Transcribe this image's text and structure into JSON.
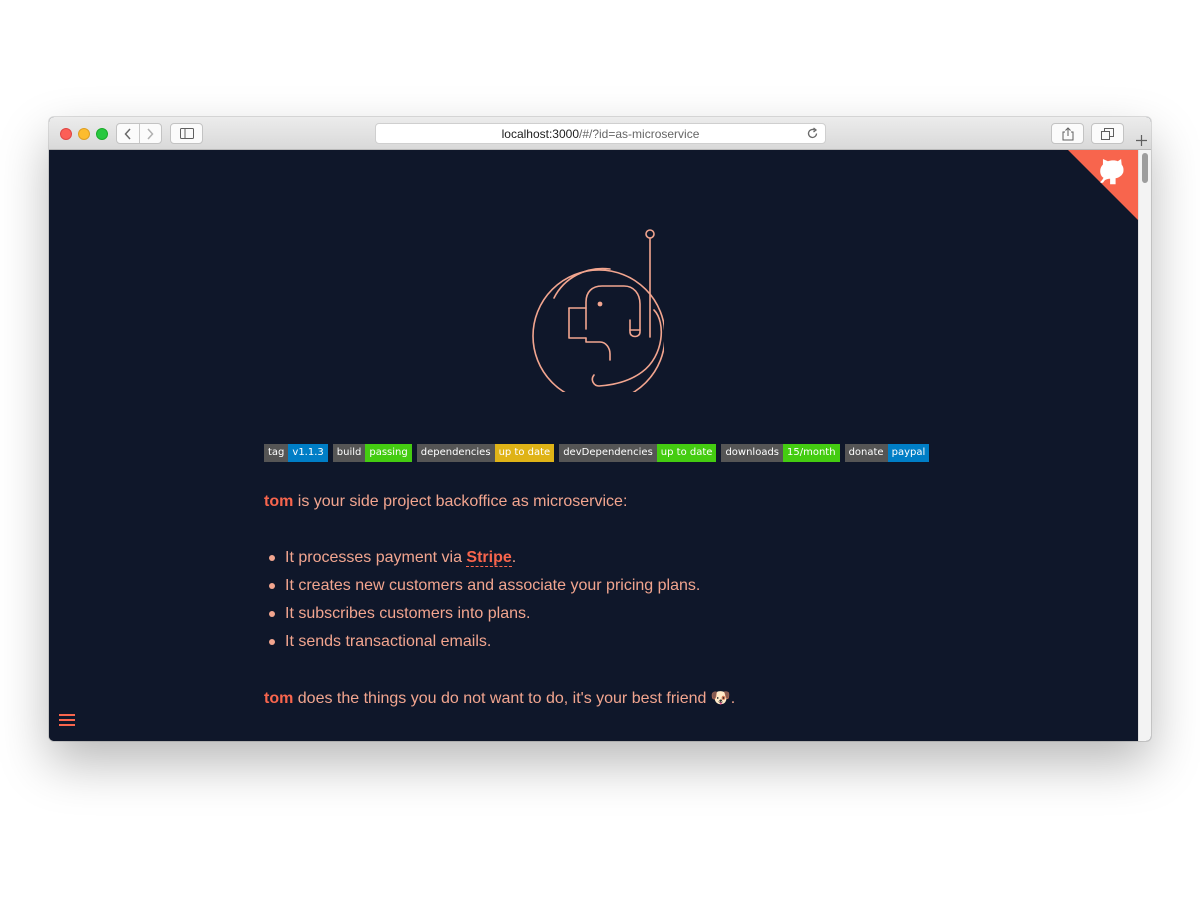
{
  "browser": {
    "address": {
      "host": "localhost:3000",
      "path": "/#/?id=as-microservice"
    }
  },
  "colors": {
    "background": "#0f172a",
    "accent": "#f8654d",
    "text": "#f2a58f",
    "badge_key": "#555555",
    "badge_blue": "#007ec6",
    "badge_green": "#44cc11",
    "badge_yellow": "#dfb317"
  },
  "badges": [
    {
      "key": "tag",
      "value": "v1.1.3",
      "color": "#007ec6"
    },
    {
      "key": "build",
      "value": "passing",
      "color": "#44cc11"
    },
    {
      "key": "dependencies",
      "value": "up to date",
      "color": "#dfb317"
    },
    {
      "key": "devDependencies",
      "value": "up to date",
      "color": "#44cc11"
    },
    {
      "key": "downloads",
      "value": "15/month",
      "color": "#44cc11"
    },
    {
      "key": "donate",
      "value": "paypal",
      "color": "#007ec6"
    }
  ],
  "intro": {
    "brand": "tom",
    "text": " is your side project backoffice as microservice:"
  },
  "features": [
    {
      "before": "It processes payment via ",
      "link": "Stripe",
      "after": "."
    },
    {
      "before": "It creates new customers and associate your pricing plans.",
      "link": "",
      "after": ""
    },
    {
      "before": "It subscribes customers into plans.",
      "link": "",
      "after": ""
    },
    {
      "before": "It sends transactional emails.",
      "link": "",
      "after": ""
    }
  ],
  "outro": {
    "brand": "tom",
    "text": " does the things you do not want to do, it's your best friend ",
    "emoji": "🐶",
    "end": "."
  },
  "icons": {
    "corner": "github-octocat-icon",
    "menu": "hamburger-menu-icon",
    "logo": "astronaut-dog-logo"
  }
}
